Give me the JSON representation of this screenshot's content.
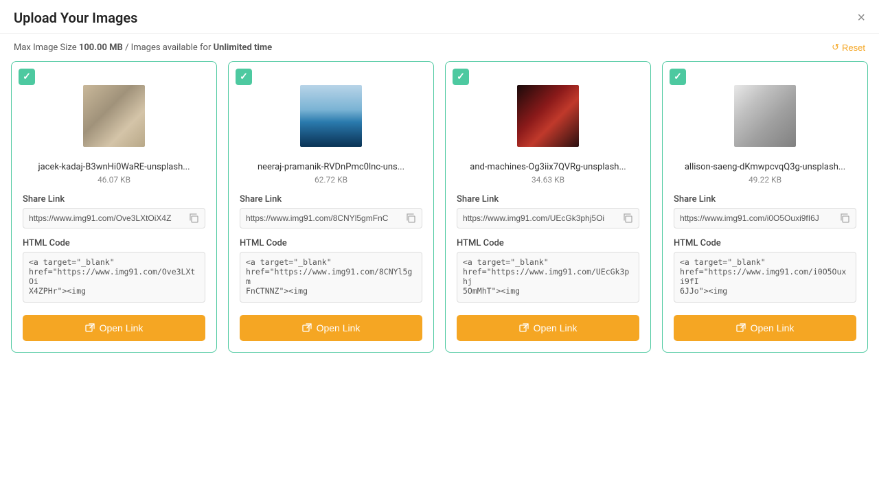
{
  "header": {
    "title": "Upload Your Images",
    "close_label": "×"
  },
  "subheader": {
    "info_prefix": "Max Image Size ",
    "max_size": "100.00 MB",
    "info_middle": " / Images available for ",
    "availability": "Unlimited time",
    "reset_label": "Reset",
    "reset_icon": "↺"
  },
  "cards": [
    {
      "id": "card-1",
      "filename": "jacek-kadaj-B3wnHi0WaRE-unsplash...",
      "filesize": "46.07 KB",
      "share_link": "https://www.img91.com/Ove3LXtOiX4Z",
      "share_link_full": "https://www.img91.com/Ove3LXtOiX4ZPHr",
      "html_code": "<a target=\"_blank\"\nhref=\"https://www.img91.com/Ove3LXtOi\nX4ZPHr\"><img",
      "open_label": "Open Link",
      "image_type": "img1"
    },
    {
      "id": "card-2",
      "filename": "neeraj-pramanik-RVDnPmc0lnc-uns...",
      "filesize": "62.72 KB",
      "share_link": "https://www.img91.com/8CNYl5gmFnC",
      "share_link_full": "https://www.img91.com/8CNYl5gmFnCTNNZ",
      "html_code": "<a target=\"_blank\"\nhref=\"https://www.img91.com/8CNYl5gm\nFnCTNNZ\"><img",
      "open_label": "Open Link",
      "image_type": "img2"
    },
    {
      "id": "card-3",
      "filename": "and-machines-Og3iix7QVRg-unsplash...",
      "filesize": "34.63 KB",
      "share_link": "https://www.img91.com/UEcGk3phj5Oi",
      "share_link_full": "https://www.img91.com/UEcGk3phj5OmMhT",
      "html_code": "<a target=\"_blank\"\nhref=\"https://www.img91.com/UEcGk3phj\n5OmMhT\"><img",
      "open_label": "Open Link",
      "image_type": "img3"
    },
    {
      "id": "card-4",
      "filename": "allison-saeng-dKmwpcvqQ3g-unsplash...",
      "filesize": "49.22 KB",
      "share_link": "https://www.img91.com/i0O5Ouxi9fI6J",
      "share_link_full": "https://www.img91.com/i0O5Ouxi9fI6JJo",
      "html_code": "<a target=\"_blank\"\nhref=\"https://www.img91.com/i0O5Ouxi9fI\n6JJo\"><img",
      "open_label": "Open Link",
      "image_type": "img4"
    }
  ],
  "labels": {
    "share_link": "Share Link",
    "html_code": "HTML Code",
    "check": "✓",
    "copy_icon": "⧉",
    "open_icon": "⧉"
  }
}
